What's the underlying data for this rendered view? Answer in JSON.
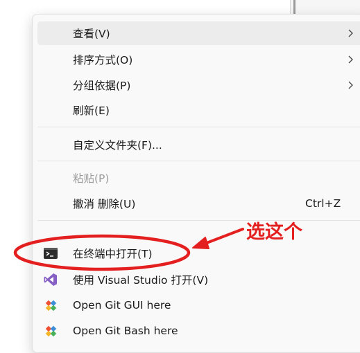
{
  "menu": {
    "items": [
      {
        "label": "查看(V)",
        "submenu": true,
        "hover": true
      },
      {
        "label": "排序方式(O)",
        "submenu": true
      },
      {
        "label": "分组依据(P)",
        "submenu": true
      },
      {
        "label": "刷新(E)"
      },
      {
        "label": "自定义文件夹(F)..."
      },
      {
        "label": "粘贴(P)",
        "disabled": true
      },
      {
        "label": "撤消 删除(U)",
        "shortcut": "Ctrl+Z"
      },
      {
        "label": "在终端中打开(T)",
        "icon": "terminal-icon"
      },
      {
        "label": "使用 Visual Studio 打开(V)",
        "icon": "visual-studio-icon"
      },
      {
        "label": "Open Git GUI here",
        "icon": "git-icon"
      },
      {
        "label": "Open Git Bash here",
        "icon": "git-icon"
      }
    ]
  },
  "annotation": {
    "text": "选这个",
    "color": "#e41f1f"
  },
  "colors": {
    "hover": "#ececec",
    "menu_bg": "#f9f9f9",
    "vs_purple": "#865fc5",
    "git_orange": "#f05133"
  }
}
